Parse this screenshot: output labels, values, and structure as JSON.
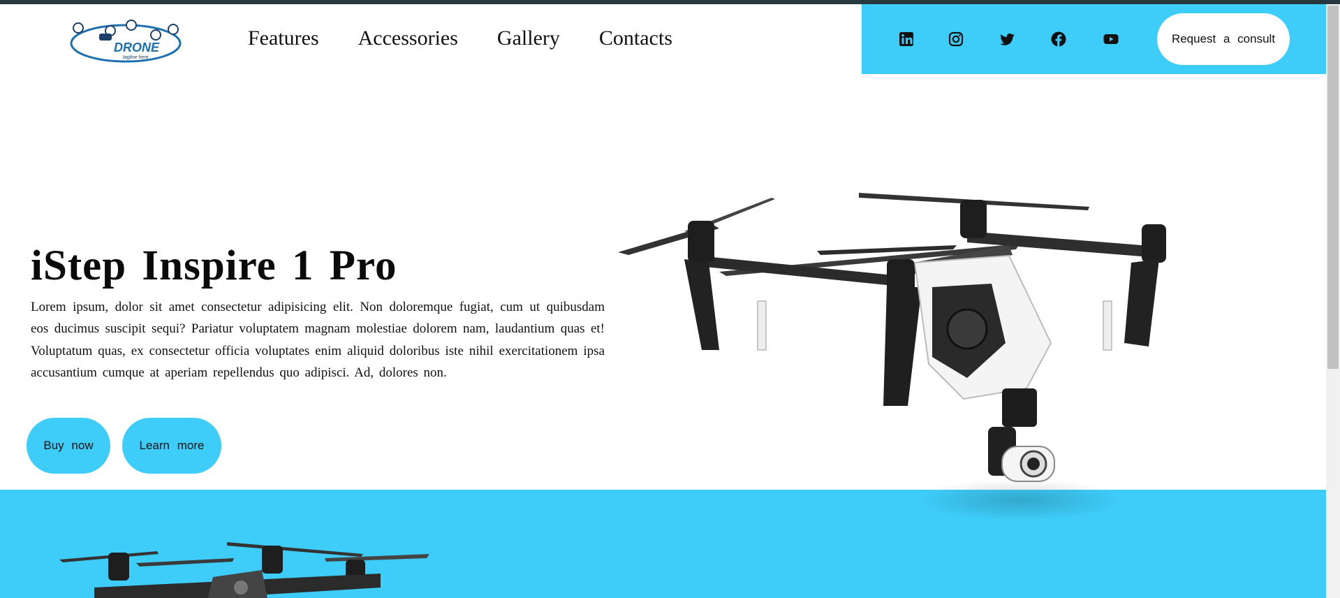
{
  "logo": {
    "text": "DRONE",
    "tagline": "tagline here",
    "color": "#1c6fb0"
  },
  "nav": {
    "items": [
      {
        "label": "Features"
      },
      {
        "label": "Accessories"
      },
      {
        "label": "Gallery"
      },
      {
        "label": "Contacts"
      }
    ]
  },
  "social": {
    "icons": [
      "linkedin-icon",
      "instagram-icon",
      "twitter-icon",
      "facebook-icon",
      "youtube-icon"
    ],
    "panel_color": "#3ecdf9"
  },
  "header": {
    "consult_label": "Request a consult"
  },
  "hero": {
    "title": "iStep Inspire 1 Pro",
    "text": "Lorem ipsum, dolor sit amet consectetur adipisicing elit. Non doloremque fugiat, cum ut quibusdam eos ducimus suscipit sequi? Pariatur voluptatem magnam molestiae dolorem nam, laudantium quas et! Voluptatum quas, ex consectetur officia voluptates enim aliquid doloribus iste nihil exercitationem ipsa accusantium cumque at aperiam repellendus quo adipisci. Ad, dolores non.",
    "buy_label": "Buy now",
    "learn_label": "Learn more"
  },
  "colors": {
    "accent": "#3ecdf9",
    "topline": "#26393f"
  }
}
